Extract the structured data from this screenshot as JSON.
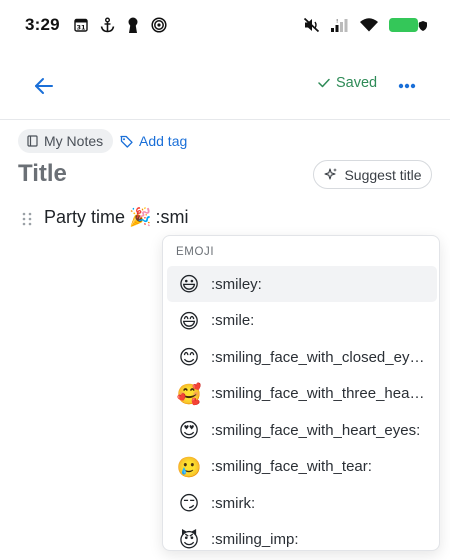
{
  "status_bar": {
    "time": "3:29",
    "left_icons": [
      "calendar-31-icon",
      "anchor-icon",
      "keyhole-icon",
      "target-icon"
    ],
    "right_icons": [
      "mute-icon",
      "signal-icon",
      "wifi-icon",
      "battery-icon"
    ],
    "calendar_day": "31",
    "battery_color": "#34c759"
  },
  "app_bar": {
    "saved_label": "Saved",
    "accent": "#1a6fd8",
    "saved_color": "#2e8b57"
  },
  "meta": {
    "notebook_chip": "My Notes",
    "add_tag": "Add tag"
  },
  "title_row": {
    "title_placeholder": "Title",
    "suggest_button": "Suggest title"
  },
  "editor": {
    "text": "Party time",
    "inline_emoji": "🎉",
    "typed_shortcode": ":smi"
  },
  "emoji_popup": {
    "header": "EMOJI",
    "selected_index": 0,
    "items": [
      {
        "emoji": "😃",
        "code": ":smiley:"
      },
      {
        "emoji": "😄",
        "code": ":smile:"
      },
      {
        "emoji": "😊",
        "code": ":smiling_face_with_closed_eyes:"
      },
      {
        "emoji": "🥰",
        "code": ":smiling_face_with_three_hearts:"
      },
      {
        "emoji": "😍",
        "code": ":smiling_face_with_heart_eyes:"
      },
      {
        "emoji": "🥲",
        "code": ":smiling_face_with_tear:"
      },
      {
        "emoji": "😏",
        "code": ":smirk:"
      },
      {
        "emoji": "😈",
        "code": ":smiling_imp:"
      }
    ]
  }
}
